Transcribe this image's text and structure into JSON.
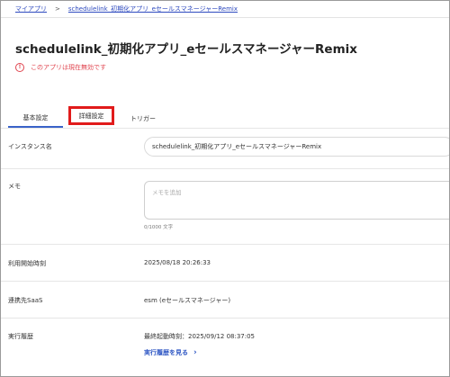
{
  "breadcrumb": {
    "root": "マイアプリ",
    "separator": ">",
    "current": "schedulelink_初期化アプリ_eセールスマネージャーRemix"
  },
  "app": {
    "title": "schedulelink_初期化アプリ_eセールスマネージャーRemix",
    "warning_icon": "!",
    "warning_text": "このアプリは現在無効です"
  },
  "tabs": [
    {
      "label": "基本設定",
      "active": true
    },
    {
      "label": "詳細設定",
      "active": false,
      "highlighted": true
    },
    {
      "label": "トリガー",
      "active": false
    }
  ],
  "fields": {
    "instance": {
      "label": "インスタンス名",
      "value": "schedulelink_初期化アプリ_eセールスマネージャーRemix"
    },
    "memo": {
      "label": "メモ",
      "placeholder": "メモを追加",
      "counter": "0/1000 文字"
    },
    "start_time": {
      "label": "利用開始時刻",
      "value": "2025/08/18 20:26:33"
    },
    "saas": {
      "label": "連携先SaaS",
      "value": "esm (eセールスマネージャー)"
    },
    "history": {
      "label": "実行履歴",
      "last_run": "最終起動時刻：2025/09/12 08:37:05",
      "link": "実行履歴を見る",
      "link_icon": "chevron-right"
    }
  },
  "colors": {
    "accent": "#2f57c4",
    "warning": "#e0454f",
    "highlight_box": "#e11b1b"
  }
}
